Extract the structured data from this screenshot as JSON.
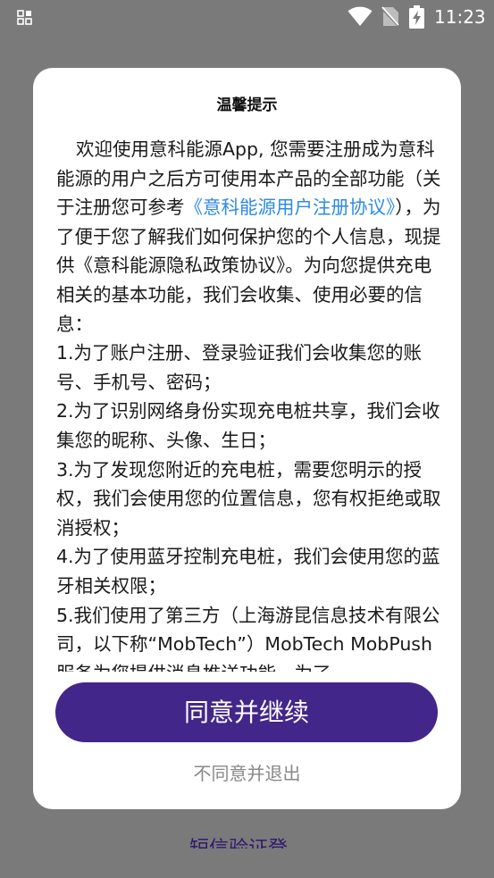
{
  "status_bar": {
    "time": "11:23",
    "icons": [
      "grid-icon",
      "wifi-icon",
      "no-sim-icon",
      "battery-charging-icon"
    ]
  },
  "background": {
    "link_text": "短信验证登录"
  },
  "dialog": {
    "title": "温馨提示",
    "body": {
      "p1_intro": "欢迎使用意科能源App, 您需要注册成为意科能源的用户之后方可使用本产品的全部功能（关于注册您可参考",
      "p1_link": "《意科能源用户注册协议》",
      "p1_rest": "），为了便于您了解我们如何保护您的个人信息，现提供《意科能源隐私政策协议》。为向您提供充电相关的基本功能，我们会收集、使用必要的信息：",
      "item1": "1.为了账户注册、登录验证我们会收集您的账号、手机号、密码；",
      "item2": "2.为了识别网络身份实现充电桩共享，我们会收集您的昵称、头像、生日；",
      "item3": " 3.为了发现您附近的充电桩，需要您明示的授权，我们会使用您的位置信息，您有权拒绝或取消授权；",
      "item4": "4.为了使用蓝牙控制充电桩，我们会使用您的蓝牙相关权限；",
      "item5": "5.我们使用了第三方（上海游昆信息技术有限公司，以下称“MobTech”）MobTech MobPush服务为您提供消息推送功能。为了"
    },
    "agree_label": "同意并继续",
    "disagree_label": "不同意并退出"
  },
  "colors": {
    "overlay": "#7a7a7a",
    "primary": "#43268a",
    "link": "#2d8ae6"
  }
}
